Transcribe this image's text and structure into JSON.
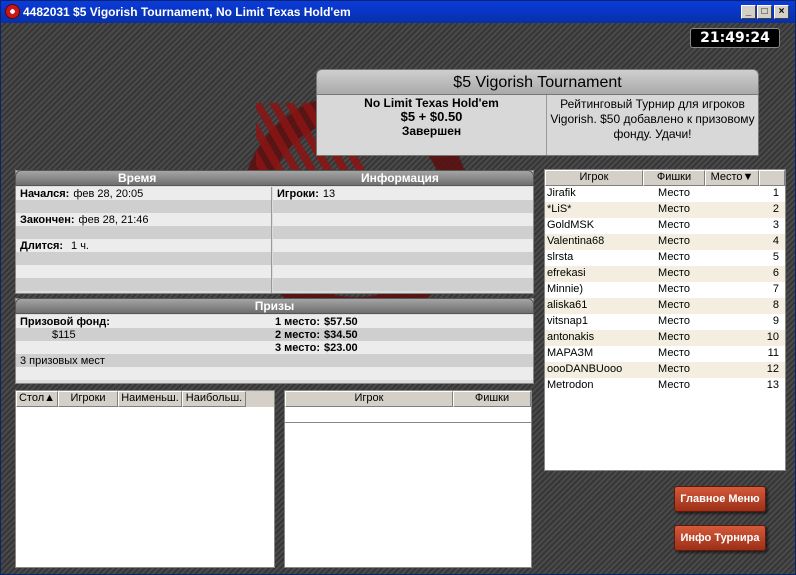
{
  "window": {
    "title": "4482031 $5 Vigorish Tournament, No Limit Texas Hold'em",
    "controls": [
      "_",
      "□",
      "×"
    ]
  },
  "clock": "21:49:24",
  "header": {
    "title": "$5 Vigorish Tournament",
    "game": "No Limit Texas Hold'em",
    "stake": "$5 + $0.50",
    "status": "Завершен",
    "description": "Рейтинговый Турнир для игроков Vigorish. $50 добавлено к призовому фонду. Удачи!"
  },
  "time_section": {
    "left_label": "Время",
    "right_label": "Информация",
    "started_label": "Начался:",
    "started_value": "фев 28, 20:05",
    "finished_label": "Закончен:",
    "finished_value": "фев 28, 21:46",
    "duration_label": "Длится:",
    "duration_value": "1 ч.",
    "players_label": "Игроки:",
    "players_value": "13"
  },
  "prizes": {
    "label": "Призы",
    "pool_label": "Призовой фонд:",
    "pool_value": "$115",
    "places_count": "3 призовых мест",
    "places": [
      {
        "label": "1 место:",
        "value": "$57.50"
      },
      {
        "label": "2 место:",
        "value": "$34.50"
      },
      {
        "label": "3 место:",
        "value": "$23.00"
      }
    ]
  },
  "tables_grid": {
    "headers": [
      "Стол▲",
      "Игроки",
      "Наименьш.",
      "Наибольш."
    ]
  },
  "players_grid": {
    "headers": [
      "Игрок",
      "Фишки"
    ]
  },
  "standings": {
    "headers": [
      "Игрок",
      "Фишки",
      "Место▼"
    ],
    "rows": [
      {
        "player": "Jirafik",
        "chips": "Место",
        "place": "1"
      },
      {
        "player": "*LiS*",
        "chips": "Место",
        "place": "2"
      },
      {
        "player": "GoldMSK",
        "chips": "Место",
        "place": "3"
      },
      {
        "player": "Valentina68",
        "chips": "Место",
        "place": "4"
      },
      {
        "player": "slrsta",
        "chips": "Место",
        "place": "5"
      },
      {
        "player": "efrekasi",
        "chips": "Место",
        "place": "6"
      },
      {
        "player": "Minnie)",
        "chips": "Место",
        "place": "7"
      },
      {
        "player": "aliska61",
        "chips": "Место",
        "place": "8"
      },
      {
        "player": "vitsnap1",
        "chips": "Место",
        "place": "9"
      },
      {
        "player": "antonakis",
        "chips": "Место",
        "place": "10"
      },
      {
        "player": "МАРАЗМ",
        "chips": "Место",
        "place": "11"
      },
      {
        "player": "oooDANBUooo",
        "chips": "Место",
        "place": "12"
      },
      {
        "player": "Metrodon",
        "chips": "Место",
        "place": "13"
      }
    ]
  },
  "buttons": {
    "main_menu": "Главное Меню",
    "tournament_info": "Инфо Турнира"
  }
}
